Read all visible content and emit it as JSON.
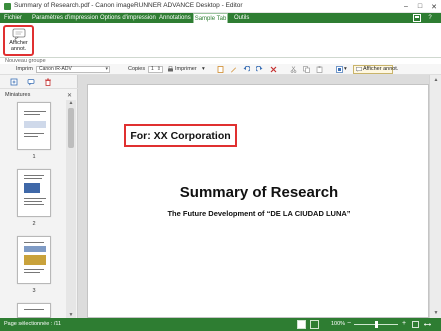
{
  "window": {
    "title": "Summary of Research.pdf - Canon imageRUNNER ADVANCE Desktop - Editor",
    "minimize": "–",
    "restore": "□",
    "close": "✕"
  },
  "ribbon": {
    "tabs": [
      "Fichier",
      "Paramètres d'impression",
      "Options d'impression",
      "Annotations",
      "Sample Tab",
      "Outils"
    ],
    "active_tab": "Sample Tab",
    "help": "?"
  },
  "ribbon_group": {
    "button_label": "Afficher\nannot.",
    "group_name": "Nouveau groupe"
  },
  "toolbar": {
    "printer_label": "Imprim",
    "printer_value": "Canon iR-ADV",
    "copies_label": "Copies",
    "copies_value": "1",
    "print_button": "Imprimer",
    "annot_button": "Afficher annot."
  },
  "thumbnails": {
    "label": "Miniatures",
    "close": "✕",
    "pages": [
      "1",
      "2",
      "3"
    ]
  },
  "document": {
    "for_text": "For: XX Corporation",
    "title": "Summary of Research",
    "subtitle": "The Future Development of “DE LA CIUDAD LUNA”"
  },
  "status": {
    "selected_text": "Page sélectionnée : /11",
    "zoom": "100%"
  },
  "colors": {
    "accent_green": "#2e7d32",
    "highlight_red": "#e03030"
  }
}
